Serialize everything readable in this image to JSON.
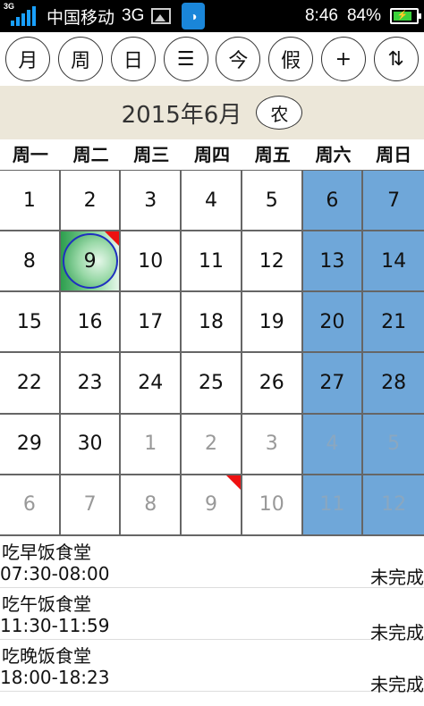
{
  "statusbar": {
    "signal_label": "3G",
    "carrier": "中国移动",
    "network": "3G",
    "time": "8:46",
    "battery": "84%"
  },
  "toolbar": {
    "buttons": [
      {
        "label": "月",
        "icon": "month"
      },
      {
        "label": "周",
        "icon": "week"
      },
      {
        "label": "日",
        "icon": "day"
      },
      {
        "label": "☰",
        "icon": "list"
      },
      {
        "label": "今",
        "icon": "today"
      },
      {
        "label": "假",
        "icon": "holiday"
      },
      {
        "label": "+",
        "icon": "add"
      },
      {
        "label": "⇅",
        "icon": "sort"
      }
    ]
  },
  "month": {
    "title": "2015年6月",
    "lunar_label": "农"
  },
  "weekdays": [
    "周一",
    "周二",
    "周三",
    "周四",
    "周五",
    "周六",
    "周日"
  ],
  "days": [
    {
      "n": "1"
    },
    {
      "n": "2"
    },
    {
      "n": "3"
    },
    {
      "n": "4"
    },
    {
      "n": "5"
    },
    {
      "n": "6",
      "weekend": true
    },
    {
      "n": "7",
      "weekend": true
    },
    {
      "n": "8"
    },
    {
      "n": "9",
      "today": true,
      "flag": true
    },
    {
      "n": "10"
    },
    {
      "n": "11"
    },
    {
      "n": "12"
    },
    {
      "n": "13",
      "weekend": true
    },
    {
      "n": "14",
      "weekend": true
    },
    {
      "n": "15"
    },
    {
      "n": "16"
    },
    {
      "n": "17"
    },
    {
      "n": "18"
    },
    {
      "n": "19"
    },
    {
      "n": "20",
      "weekend": true
    },
    {
      "n": "21",
      "weekend": true
    },
    {
      "n": "22"
    },
    {
      "n": "23"
    },
    {
      "n": "24"
    },
    {
      "n": "25"
    },
    {
      "n": "26"
    },
    {
      "n": "27",
      "weekend": true
    },
    {
      "n": "28",
      "weekend": true
    },
    {
      "n": "29"
    },
    {
      "n": "30"
    },
    {
      "n": "1",
      "other": true
    },
    {
      "n": "2",
      "other": true
    },
    {
      "n": "3",
      "other": true
    },
    {
      "n": "4",
      "other": true,
      "weekend": true
    },
    {
      "n": "5",
      "other": true,
      "weekend": true
    },
    {
      "n": "6",
      "other": true
    },
    {
      "n": "7",
      "other": true
    },
    {
      "n": "8",
      "other": true
    },
    {
      "n": "9",
      "other": true,
      "flag": true
    },
    {
      "n": "10",
      "other": true
    },
    {
      "n": "11",
      "other": true,
      "weekend": true
    },
    {
      "n": "12",
      "other": true,
      "weekend": true
    }
  ],
  "events": [
    {
      "title": "吃早饭食堂",
      "time": "07:30-08:00",
      "status": "未完成"
    },
    {
      "title": "吃午饭食堂",
      "time": "11:30-11:59",
      "status": "未完成"
    },
    {
      "title": "吃晚饭食堂",
      "time": "18:00-18:23",
      "status": "未完成"
    }
  ],
  "colors": {
    "weekend": "#6fa7d9",
    "header_bg": "#ece7d9",
    "flag": "#e11111",
    "today_ring": "#1f2fc0"
  }
}
